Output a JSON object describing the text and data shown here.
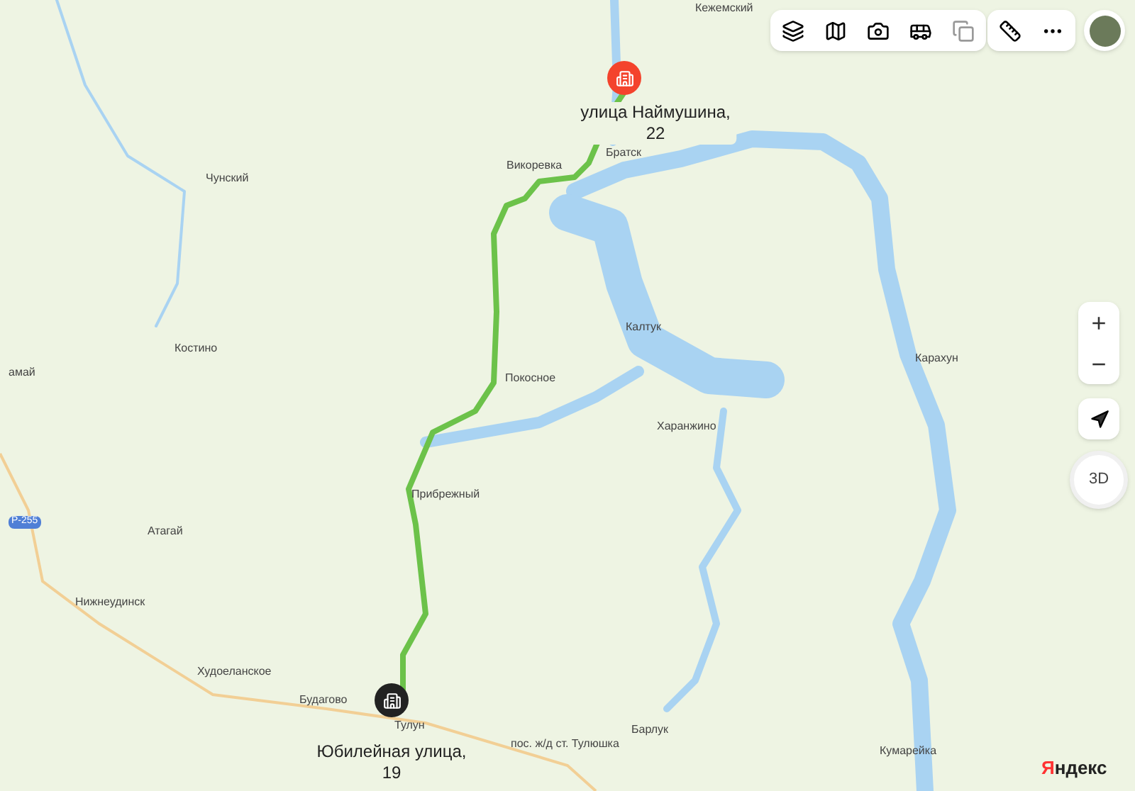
{
  "map": {
    "places": [
      {
        "name": "Кежемский"
      },
      {
        "name": "Чунский"
      },
      {
        "name": "Викоревка"
      },
      {
        "name": "Братск"
      },
      {
        "name": "Костино"
      },
      {
        "name": "амай"
      },
      {
        "name": "Калтук"
      },
      {
        "name": "Карахун"
      },
      {
        "name": "Покосное"
      },
      {
        "name": "Харанжино"
      },
      {
        "name": "Прибрежный"
      },
      {
        "name": "Атагай"
      },
      {
        "name": "Нижнеудинск"
      },
      {
        "name": "Худоеланское"
      },
      {
        "name": "Будагово"
      },
      {
        "name": "Тулун"
      },
      {
        "name": "Барлук"
      },
      {
        "name": "Кумарейка"
      },
      {
        "name": "пос. ж/д ст. Тулюшка"
      }
    ],
    "road_badge": "Р-255",
    "markers": [
      {
        "kind": "finish",
        "address": "улица Наймушина,",
        "number": "22"
      },
      {
        "kind": "start",
        "address": "Юбилейная улица,",
        "number": "19"
      }
    ]
  },
  "controls": {
    "zoom_in": "+",
    "zoom_out": "−",
    "view_3d": "3D"
  },
  "logo": {
    "first": "Я",
    "rest": "ндекс"
  }
}
